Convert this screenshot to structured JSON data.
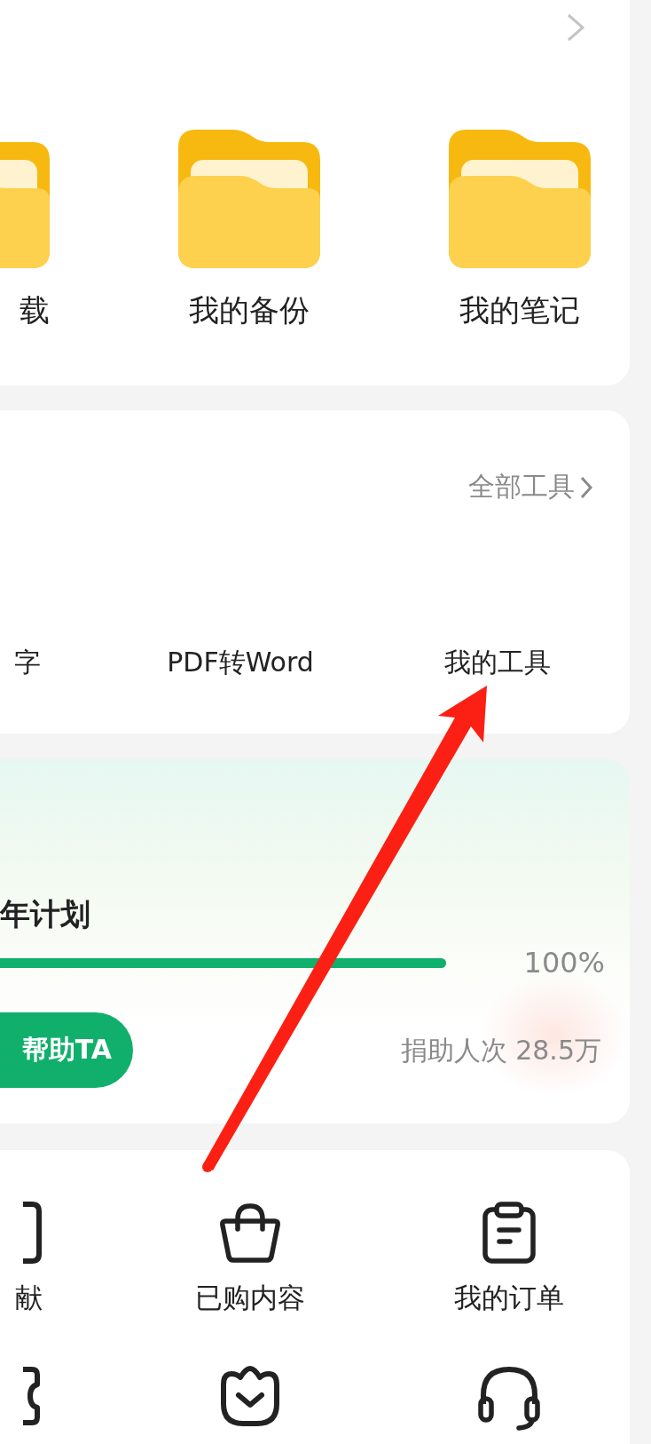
{
  "files_card": {
    "items": [
      {
        "label": "载",
        "kind": "partial"
      },
      {
        "label": "我的备份",
        "kind": "full"
      },
      {
        "label": "我的笔记",
        "kind": "full"
      }
    ]
  },
  "tools_card": {
    "all_tools_link": "全部工具",
    "tools": [
      {
        "label": "字",
        "kind": "partial"
      },
      {
        "label": "PDF转Word",
        "kind": "full"
      },
      {
        "label": "我的工具",
        "kind": "full"
      }
    ]
  },
  "charity_card": {
    "title": "年计划",
    "level": 1.0,
    "percent": "100%",
    "button": "帮助TA",
    "donors": "捐助人次 28.5万"
  },
  "services_card": {
    "rows": [
      [
        {
          "label": "献",
          "kind": "labeled"
        },
        {
          "label": "已购内容",
          "kind": "labeled"
        },
        {
          "label": "我的订单",
          "kind": "labeled"
        }
      ],
      [
        {
          "kind": "icon-only"
        },
        {
          "kind": "icon-only"
        },
        {
          "kind": "icon-only"
        }
      ]
    ]
  },
  "annotation": {
    "kind": "arrow"
  }
}
